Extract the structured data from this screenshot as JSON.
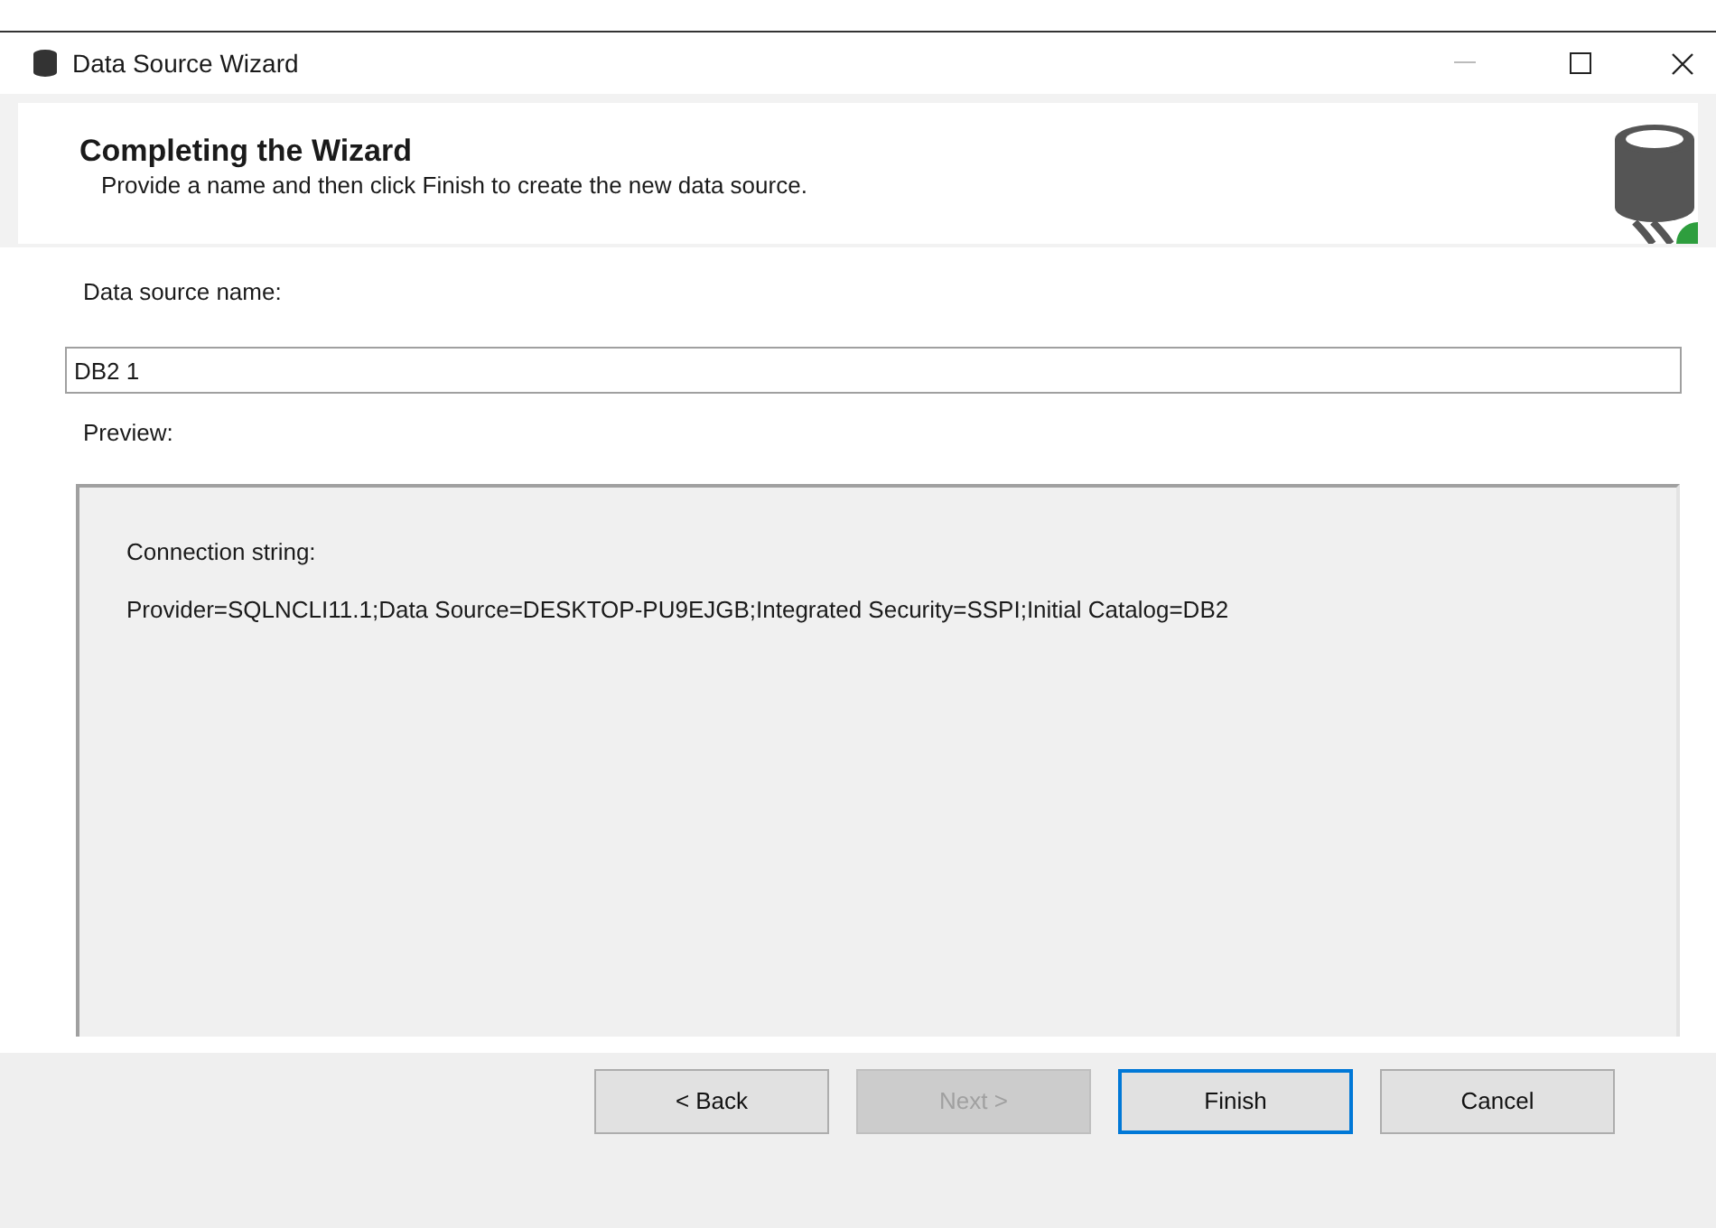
{
  "window": {
    "title": "Data Source Wizard"
  },
  "header": {
    "title": "Completing the Wizard",
    "subtitle": "Provide a name and then click Finish to create the new data source."
  },
  "name_field": {
    "label": "Data source name:",
    "value": "DB2 1"
  },
  "preview": {
    "label": "Preview:",
    "heading": "Connection string:",
    "text": "Provider=SQLNCLI11.1;Data Source=DESKTOP-PU9EJGB;Integrated Security=SSPI;Initial Catalog=DB2"
  },
  "buttons": [
    {
      "label": "< Back",
      "disabled": false,
      "default": false
    },
    {
      "label": "Next >",
      "disabled": true,
      "default": false
    },
    {
      "label": "Finish",
      "disabled": false,
      "default": true
    },
    {
      "label": "Cancel",
      "disabled": false,
      "default": false
    }
  ]
}
